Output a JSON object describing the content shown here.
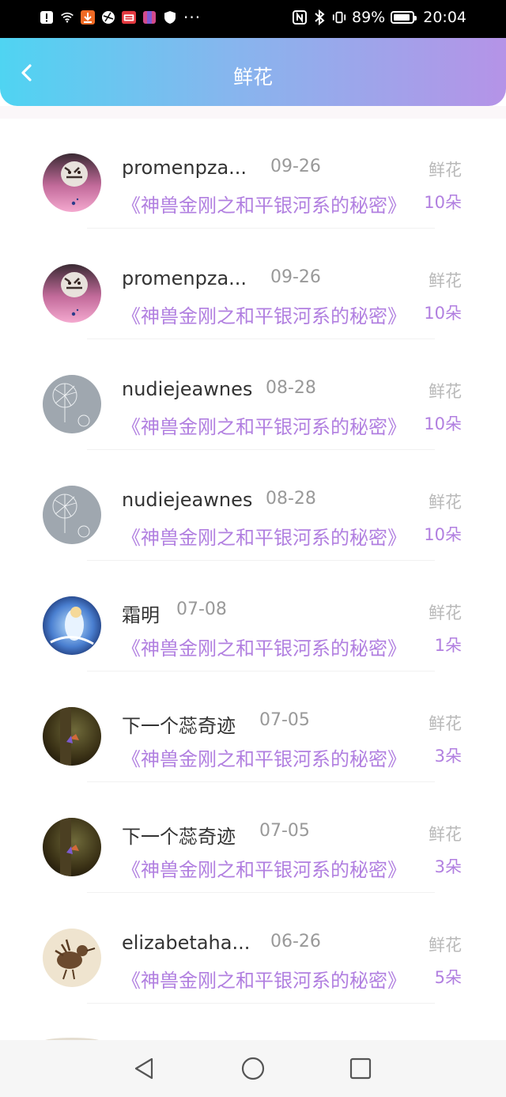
{
  "status_bar": {
    "battery": "89%",
    "battery_level": 0.89,
    "time": "20:04",
    "left_icons": [
      "alert-icon",
      "wifi-icon",
      "download-icon",
      "app-icon",
      "app-icon",
      "app-icon",
      "shield-icon",
      "more-icon"
    ],
    "right_icons": [
      "nfc-icon",
      "bluetooth-icon",
      "vibrate-icon",
      "battery-icon"
    ]
  },
  "header": {
    "title": "鲜花",
    "back_icon": "chevron-left-icon"
  },
  "records": [
    {
      "name": "promenpza...",
      "date": "09-26",
      "type": "鲜花",
      "gift": "《神兽金刚之和平银河系的秘密》",
      "count": "10朵",
      "avatar": "tiger"
    },
    {
      "name": "promenpza...",
      "date": "09-26",
      "type": "鲜花",
      "gift": "《神兽金刚之和平银河系的秘密》",
      "count": "10朵",
      "avatar": "tiger"
    },
    {
      "name": "nudiejeawnes",
      "date": "08-28",
      "type": "鲜花",
      "gift": "《神兽金刚之和平银河系的秘密》",
      "count": "10朵",
      "avatar": "dandelion"
    },
    {
      "name": "nudiejeawnes",
      "date": "08-28",
      "type": "鲜花",
      "gift": "《神兽金刚之和平银河系的秘密》",
      "count": "10朵",
      "avatar": "dandelion"
    },
    {
      "name": "霜明",
      "date": "07-08",
      "type": "鲜花",
      "gift": "《神兽金刚之和平银河系的秘密》",
      "count": "1朵",
      "avatar": "fantasy"
    },
    {
      "name": "下一个蕊奇迹",
      "date": "07-05",
      "type": "鲜花",
      "gift": "《神兽金刚之和平银河系的秘密》",
      "count": "3朵",
      "avatar": "forest"
    },
    {
      "name": "下一个蕊奇迹",
      "date": "07-05",
      "type": "鲜花",
      "gift": "《神兽金刚之和平银河系的秘密》",
      "count": "3朵",
      "avatar": "forest"
    },
    {
      "name": "elizabetaha...",
      "date": "06-26",
      "type": "鲜花",
      "gift": "《神兽金刚之和平银河系的秘密》",
      "count": "5朵",
      "avatar": "bird"
    }
  ],
  "nav_bar": {
    "icons": [
      "back-triangle-icon",
      "home-circle-icon",
      "recents-square-icon"
    ]
  },
  "colors": {
    "header_gradient_start": "#4fd4f2",
    "header_gradient_end": "#b593e7",
    "gift_purple": "#b17fe0",
    "muted_gray": "#999999"
  }
}
